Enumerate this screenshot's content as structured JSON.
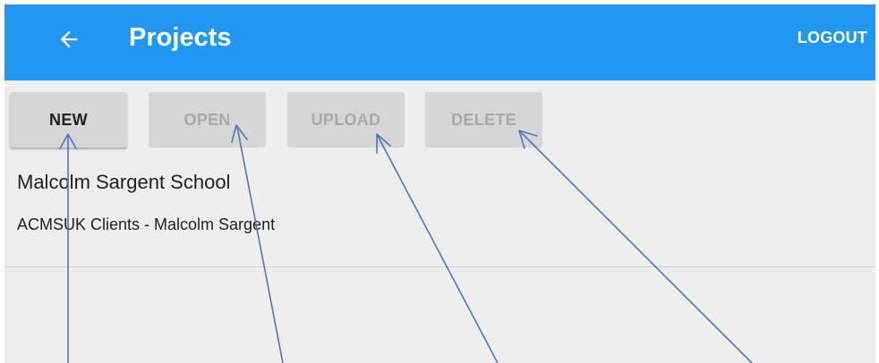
{
  "app_bar": {
    "title": "Projects",
    "back_icon": "arrow-back-icon",
    "logout_label": "LOGOUT",
    "color": "#2196f3"
  },
  "toolbar": {
    "new_label": "NEW",
    "open_label": "OPEN",
    "upload_label": "UPLOAD",
    "delete_label": "DELETE"
  },
  "projects": [
    {
      "name": "Malcolm Sargent School",
      "client": "ACMSUK Clients - Malcolm Sargent"
    }
  ],
  "annotation_color": "#4a78b8"
}
